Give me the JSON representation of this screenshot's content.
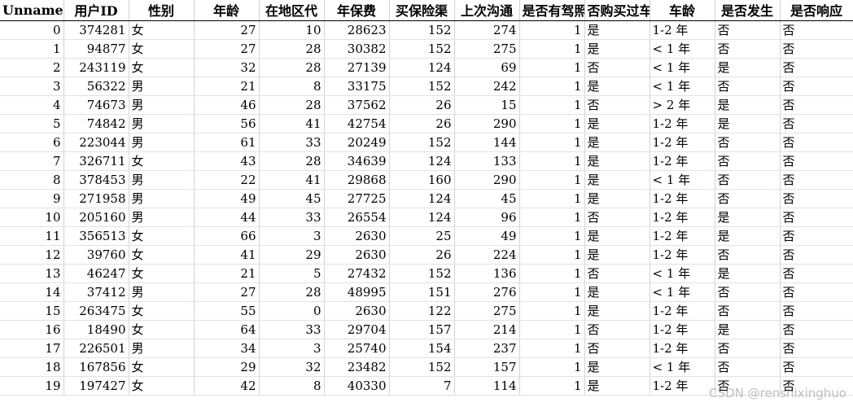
{
  "columns": [
    "Unnamed:",
    "用户ID",
    "性别",
    "年龄",
    "在地区代",
    "年保费",
    "买保险渠",
    "上次沟通",
    "是否有驾照",
    "否购买过车",
    "车龄",
    "是否发生",
    "是否响应"
  ],
  "rows": [
    [
      "0",
      "374281",
      "女",
      "27",
      "10",
      "28623",
      "152",
      "274",
      "1",
      "是",
      "1-2 年",
      "否",
      "否"
    ],
    [
      "1",
      "94877",
      "女",
      "27",
      "28",
      "30382",
      "152",
      "275",
      "1",
      "是",
      "< 1 年",
      "否",
      "否"
    ],
    [
      "2",
      "243119",
      "女",
      "32",
      "28",
      "27139",
      "124",
      "69",
      "1",
      "否",
      "< 1 年",
      "是",
      "否"
    ],
    [
      "3",
      "56322",
      "男",
      "21",
      "8",
      "33175",
      "152",
      "242",
      "1",
      "是",
      "< 1 年",
      "否",
      "否"
    ],
    [
      "4",
      "74673",
      "男",
      "46",
      "28",
      "37562",
      "26",
      "15",
      "1",
      "否",
      "> 2 年",
      "是",
      "否"
    ],
    [
      "5",
      "74842",
      "男",
      "56",
      "41",
      "42754",
      "26",
      "290",
      "1",
      "是",
      "1-2 年",
      "是",
      "否"
    ],
    [
      "6",
      "223044",
      "男",
      "61",
      "33",
      "20249",
      "152",
      "144",
      "1",
      "是",
      "1-2 年",
      "否",
      "否"
    ],
    [
      "7",
      "326711",
      "女",
      "43",
      "28",
      "34639",
      "124",
      "133",
      "1",
      "是",
      "1-2 年",
      "否",
      "否"
    ],
    [
      "8",
      "378453",
      "男",
      "22",
      "41",
      "29868",
      "160",
      "290",
      "1",
      "是",
      "< 1 年",
      "否",
      "否"
    ],
    [
      "9",
      "271958",
      "男",
      "49",
      "45",
      "27725",
      "124",
      "45",
      "1",
      "是",
      "1-2 年",
      "否",
      "否"
    ],
    [
      "10",
      "205160",
      "男",
      "44",
      "33",
      "26554",
      "124",
      "96",
      "1",
      "否",
      "1-2 年",
      "是",
      "否"
    ],
    [
      "11",
      "356513",
      "女",
      "66",
      "3",
      "2630",
      "25",
      "49",
      "1",
      "是",
      "1-2 年",
      "是",
      "否"
    ],
    [
      "12",
      "39760",
      "女",
      "41",
      "29",
      "2630",
      "26",
      "224",
      "1",
      "是",
      "1-2 年",
      "否",
      "否"
    ],
    [
      "13",
      "46247",
      "女",
      "21",
      "5",
      "27432",
      "152",
      "136",
      "1",
      "否",
      "< 1 年",
      "是",
      "否"
    ],
    [
      "14",
      "37412",
      "男",
      "27",
      "28",
      "48995",
      "151",
      "276",
      "1",
      "是",
      "< 1 年",
      "否",
      "否"
    ],
    [
      "15",
      "263475",
      "女",
      "55",
      "0",
      "2630",
      "122",
      "275",
      "1",
      "是",
      "1-2 年",
      "否",
      "否"
    ],
    [
      "16",
      "18490",
      "女",
      "64",
      "33",
      "29704",
      "157",
      "214",
      "1",
      "否",
      "1-2 年",
      "是",
      "否"
    ],
    [
      "17",
      "226501",
      "男",
      "34",
      "3",
      "25740",
      "154",
      "237",
      "1",
      "否",
      "1-2 年",
      "否",
      "否"
    ],
    [
      "18",
      "167856",
      "女",
      "29",
      "32",
      "23482",
      "152",
      "157",
      "1",
      "是",
      "< 1 年",
      "否",
      "否"
    ],
    [
      "19",
      "197427",
      "女",
      "42",
      "8",
      "40330",
      "7",
      "114",
      "1",
      "是",
      "1-2 年",
      "否",
      "否"
    ]
  ],
  "watermark": "CSDN @renshixinghuo"
}
